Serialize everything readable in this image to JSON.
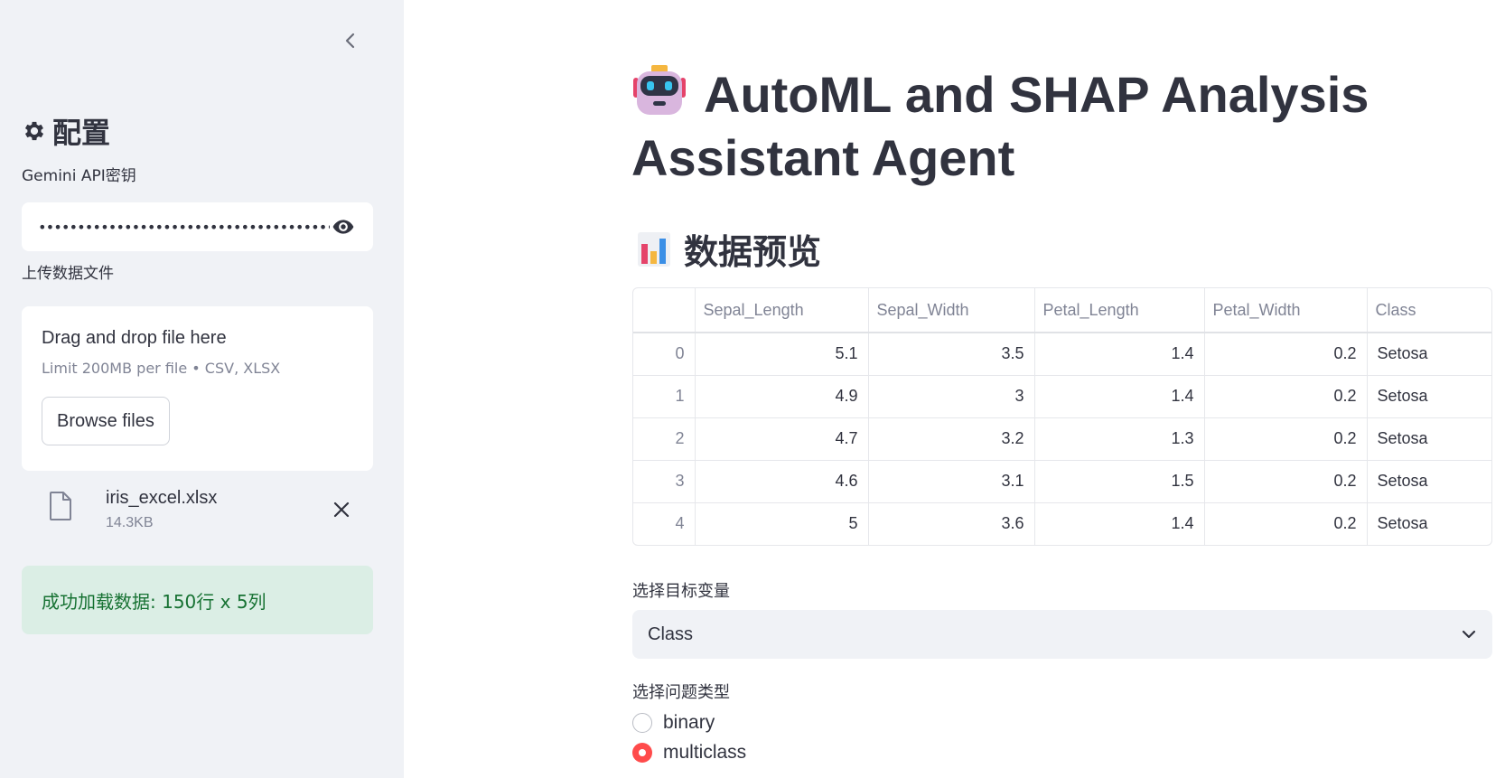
{
  "sidebar": {
    "title": "配置",
    "api_key_label": "Gemini API密钥",
    "api_key_masked": "••••••••••••••••••••••••••••••••••••••",
    "upload_label": "上传数据文件",
    "uploader": {
      "drag_text": "Drag and drop file here",
      "limit_text": "Limit 200MB per file • CSV, XLSX",
      "browse_label": "Browse files"
    },
    "file": {
      "name": "iris_excel.xlsx",
      "size": "14.3KB"
    },
    "success_message": "成功加载数据: 150行 x 5列"
  },
  "main": {
    "title": "AutoML and SHAP Analysis Assistant Agent",
    "preview_title": "数据预览",
    "table": {
      "columns": [
        "Sepal_Length",
        "Sepal_Width",
        "Petal_Length",
        "Petal_Width",
        "Class"
      ],
      "rows": [
        {
          "index": "0",
          "cells": [
            "5.1",
            "3.5",
            "1.4",
            "0.2",
            "Setosa"
          ]
        },
        {
          "index": "1",
          "cells": [
            "4.9",
            "3",
            "1.4",
            "0.2",
            "Setosa"
          ]
        },
        {
          "index": "2",
          "cells": [
            "4.7",
            "3.2",
            "1.3",
            "0.2",
            "Setosa"
          ]
        },
        {
          "index": "3",
          "cells": [
            "4.6",
            "3.1",
            "1.5",
            "0.2",
            "Setosa"
          ]
        },
        {
          "index": "4",
          "cells": [
            "5",
            "3.6",
            "1.4",
            "0.2",
            "Setosa"
          ]
        }
      ]
    },
    "target_label": "选择目标变量",
    "target_value": "Class",
    "problem_label": "选择问题类型",
    "problem_options": [
      {
        "label": "binary",
        "checked": false
      },
      {
        "label": "multiclass",
        "checked": true
      }
    ]
  },
  "colors": {
    "accent": "#ff4b4b",
    "success_bg": "#dbeee5",
    "success_text": "#177233",
    "sidebar_bg": "#f0f2f6"
  }
}
